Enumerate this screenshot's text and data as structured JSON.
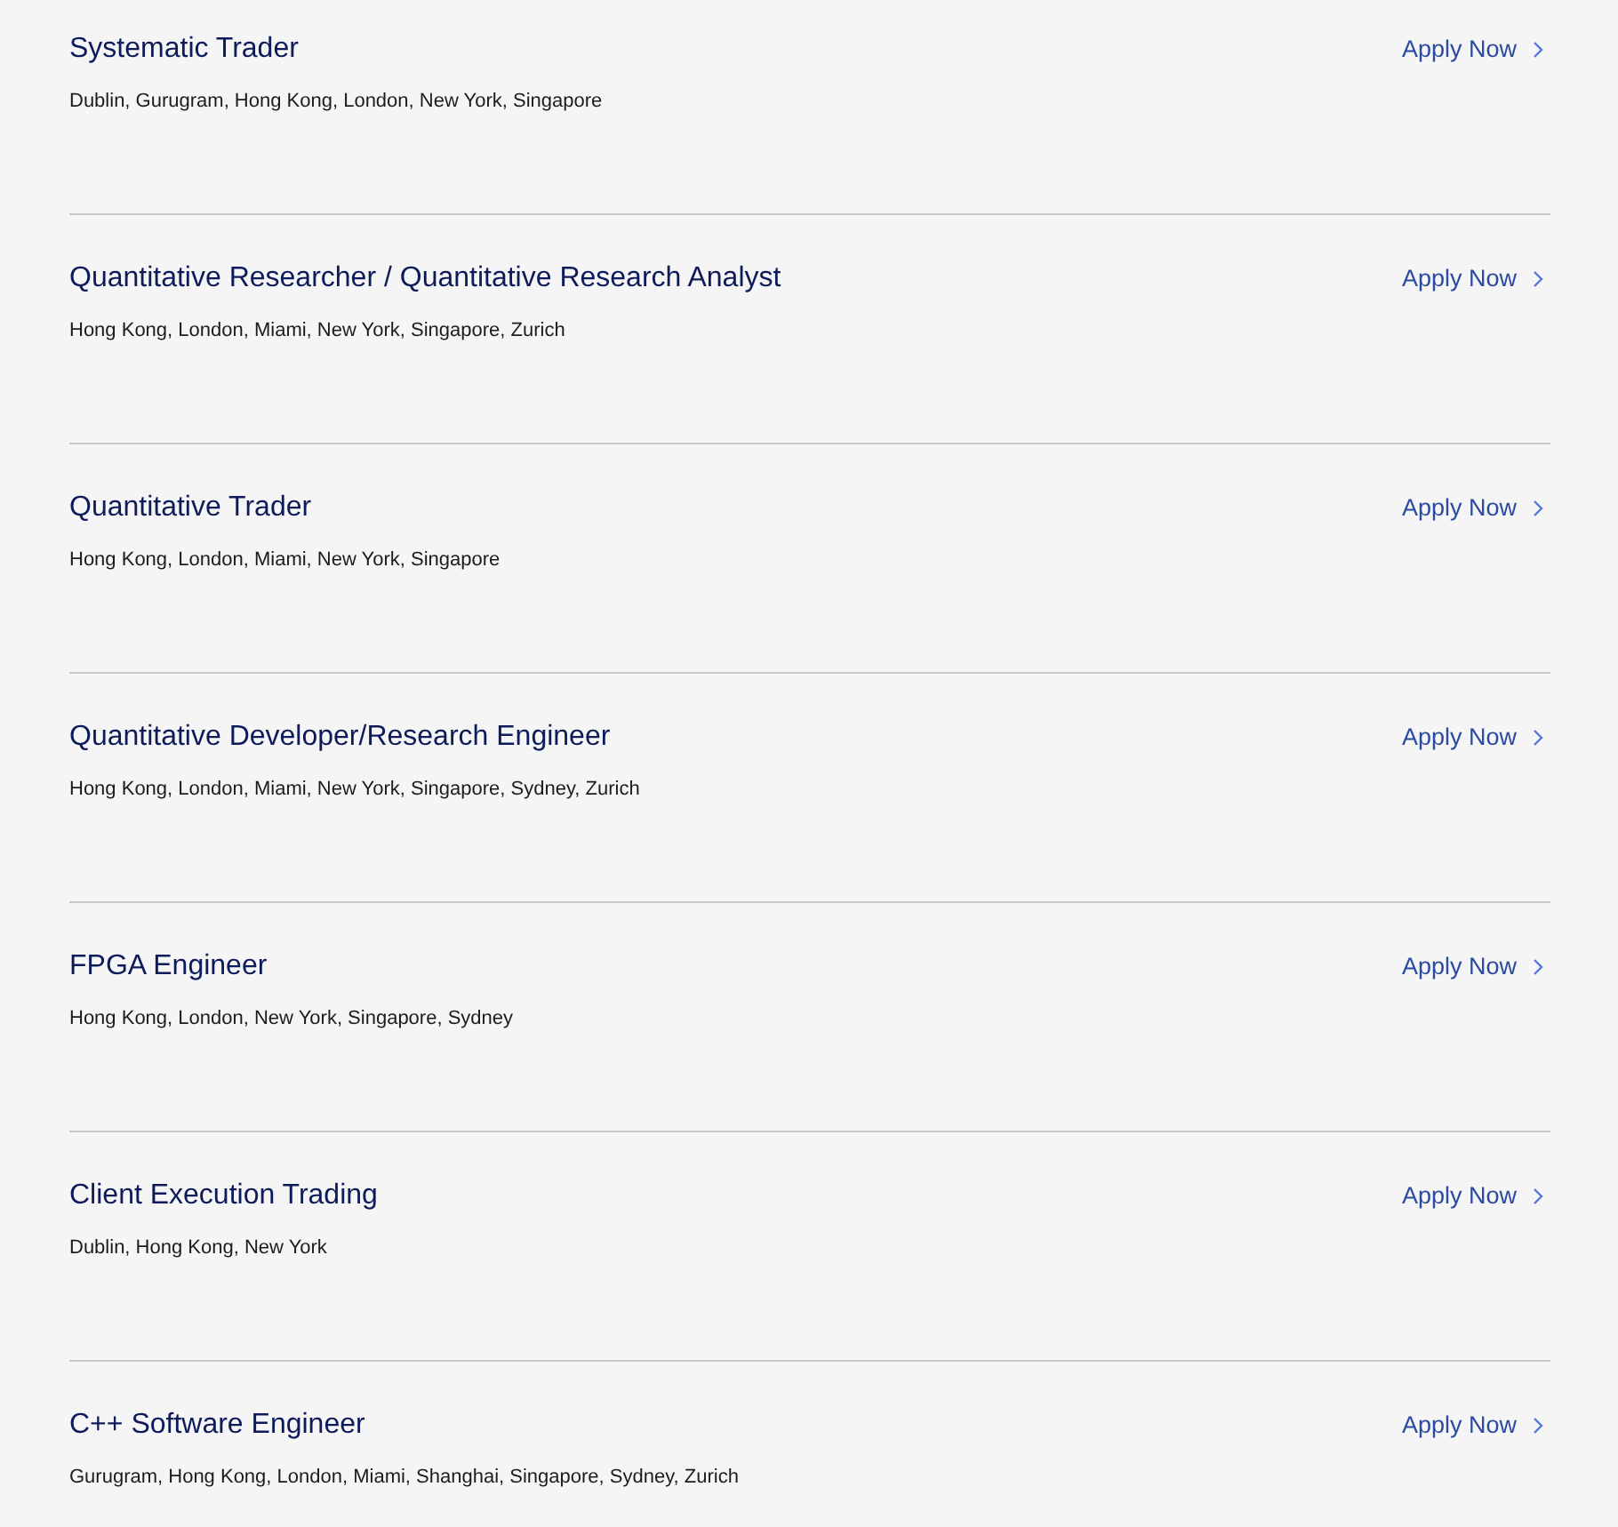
{
  "jobs": [
    {
      "title": "Systematic Trader",
      "locations": "Dublin, Gurugram, Hong Kong, London, New York, Singapore",
      "apply": "Apply Now"
    },
    {
      "title": "Quantitative Researcher / Quantitative Research Analyst",
      "locations": "Hong Kong, London, Miami, New York, Singapore, Zurich",
      "apply": "Apply Now"
    },
    {
      "title": "Quantitative Trader",
      "locations": "Hong Kong, London, Miami, New York, Singapore",
      "apply": "Apply Now"
    },
    {
      "title": "Quantitative Developer/Research Engineer",
      "locations": "Hong Kong, London, Miami, New York, Singapore, Sydney, Zurich",
      "apply": "Apply Now"
    },
    {
      "title": "FPGA Engineer",
      "locations": "Hong Kong, London, New York, Singapore, Sydney",
      "apply": "Apply Now"
    },
    {
      "title": "Client Execution Trading",
      "locations": "Dublin, Hong Kong, New York",
      "apply": "Apply Now"
    },
    {
      "title": "C++ Software Engineer",
      "locations": "Gurugram, Hong Kong, London, Miami, Shanghai, Singapore, Sydney, Zurich",
      "apply": "Apply Now"
    }
  ]
}
